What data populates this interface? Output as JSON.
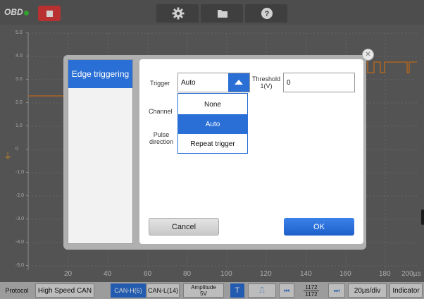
{
  "app": {
    "logo": "OBD"
  },
  "scope": {
    "y_ticks": [
      "5.0",
      "4.0",
      "3.0",
      "2.0",
      "1.0",
      "0",
      "-1.0",
      "-2.0",
      "-3.0",
      "-4.0",
      "-5.0"
    ],
    "x_ticks": [
      "20",
      "40",
      "60",
      "80",
      "100",
      "120",
      "140",
      "160",
      "180",
      "200µs"
    ],
    "colors": {
      "trace": "#d07a2a",
      "background": "#666666",
      "grid": "#7a7a7a"
    }
  },
  "bottombar": {
    "protocol_label": "Protocol",
    "protocol_value": "High Speed CAN",
    "can_h": "CAN-H(6)",
    "can_l": "CAN-L(14)",
    "amplitude_label": "Amplitude",
    "amplitude_value": "5V",
    "trigger_mode": "T",
    "edge_symbol": "⎍",
    "frame_current": "1172",
    "frame_total": "1172",
    "timebase": "20µs/div",
    "indicator": "Indicator"
  },
  "dialog": {
    "side_tab": "Edge triggering",
    "trigger_label": "Trigger",
    "trigger_value": "Auto",
    "threshold_label": "Threshold 1(V)",
    "threshold_value": "0",
    "channel_label": "Channel",
    "pulse_label": "Pulse direction",
    "options": [
      "None",
      "Auto",
      "Repeat trigger"
    ],
    "selected_option": "Auto",
    "cancel": "Cancel",
    "ok": "OK"
  },
  "colors": {
    "accent": "#2a6fd6",
    "stop": "#e23b3b",
    "status_green": "#3fc23a"
  }
}
